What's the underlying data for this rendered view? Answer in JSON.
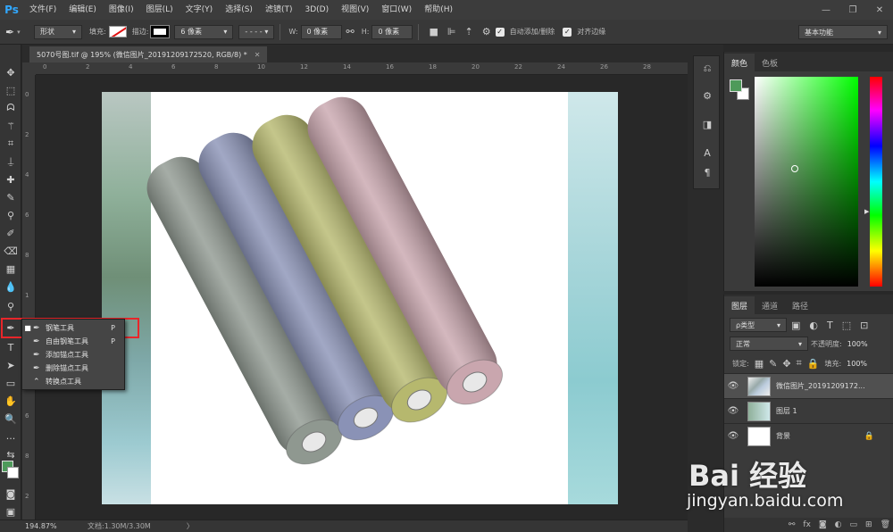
{
  "app": {
    "logo": "Ps"
  },
  "menu": [
    "文件(F)",
    "编辑(E)",
    "图像(I)",
    "图层(L)",
    "文字(Y)",
    "选择(S)",
    "滤镜(T)",
    "3D(D)",
    "视图(V)",
    "窗口(W)",
    "帮助(H)"
  ],
  "window_controls": {
    "minimize": "—",
    "restore": "❐",
    "close": "✕"
  },
  "options": {
    "mode": "形状",
    "fill_label": "填充:",
    "stroke_label": "描边:",
    "stroke_width": "6 像素",
    "w_label": "W:",
    "w_value": "0 像素",
    "h_label": "H:",
    "h_value": "0 像素",
    "auto_add_delete": "自动添加/删除",
    "align_edges": "对齐边缘",
    "workspace": "基本功能"
  },
  "document": {
    "tab_title": "5070号图.tif @ 195% (微信图片_20191209172520, RGB/8) *",
    "tab_close": "✕"
  },
  "ruler_top": [
    "0",
    "2",
    "4",
    "6",
    "8",
    "10",
    "12",
    "14",
    "16",
    "18",
    "20",
    "22",
    "24",
    "26",
    "28"
  ],
  "ruler_left": [
    "0",
    "2",
    "4",
    "6",
    "8",
    "1",
    "2",
    "4",
    "6",
    "8",
    "2"
  ],
  "status": {
    "zoom": "194.87%",
    "doc": "文档:1.30M/3.30M",
    "arrow": "〉"
  },
  "color_panel": {
    "tabs": [
      "颜色",
      "色板"
    ],
    "fg": "#4e9a5a",
    "bg": "#ffffff"
  },
  "layers_panel": {
    "tabs": [
      "图层",
      "通道",
      "路径"
    ],
    "filter_type": "ρ类型",
    "blend_mode": "正常",
    "opacity_label": "不透明度:",
    "opacity_value": "100%",
    "lock_label": "锁定:",
    "fill_label": "填充:",
    "fill_value": "100%",
    "layers": [
      {
        "name": "微信图片_20191209172...",
        "selected": true
      },
      {
        "name": "图层 1",
        "selected": false
      },
      {
        "name": "背景",
        "selected": false,
        "locked": true
      }
    ]
  },
  "flyout": {
    "items": [
      {
        "label": "钢笔工具",
        "key": "P",
        "active": true
      },
      {
        "label": "自由钢笔工具",
        "key": "P",
        "active": false
      },
      {
        "label": "添加锚点工具",
        "key": "",
        "active": false
      },
      {
        "label": "删除锚点工具",
        "key": "",
        "active": false
      },
      {
        "label": "转换点工具",
        "key": "",
        "active": false
      }
    ]
  },
  "watermark": {
    "brand": "Bai 经验",
    "url": "jingyan.baidu.com"
  },
  "rolls": [
    {
      "color": "#8f9890"
    },
    {
      "color": "#8a92b6"
    },
    {
      "color": "#b6b86e"
    },
    {
      "color": "#c9a6ae"
    }
  ]
}
